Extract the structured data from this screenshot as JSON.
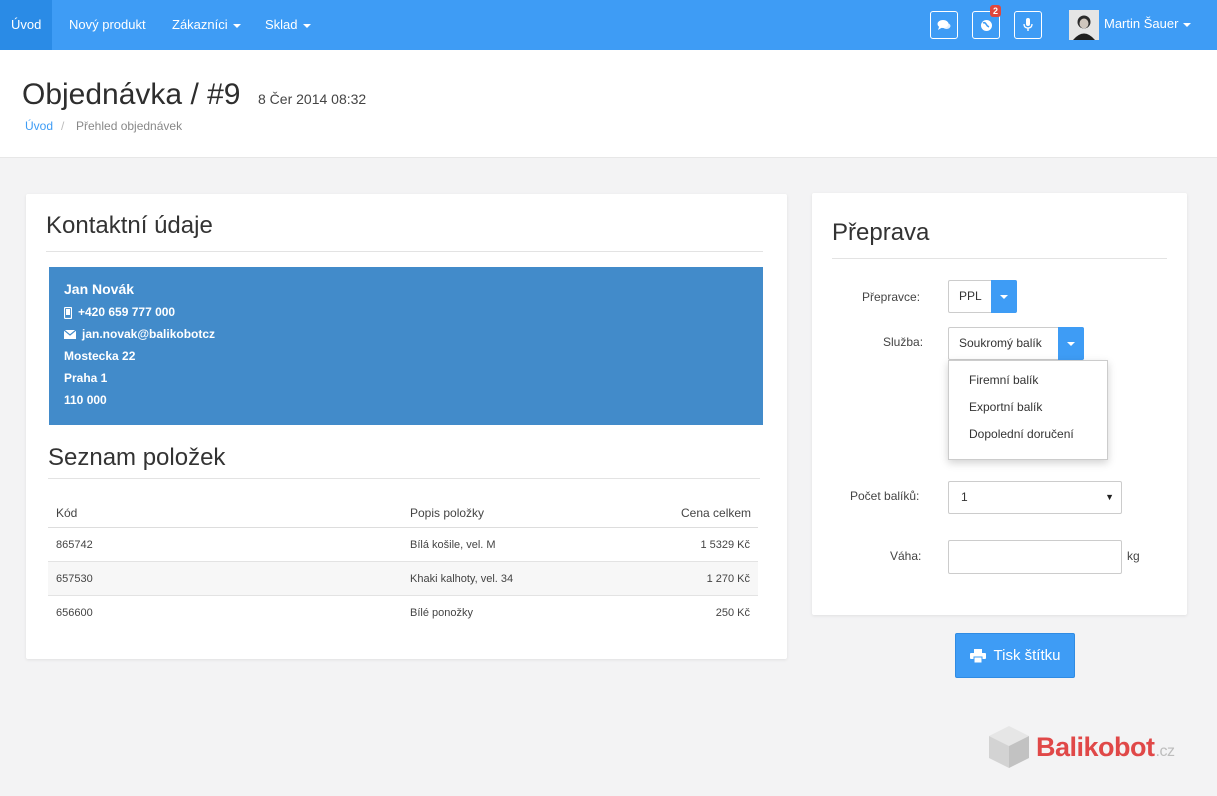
{
  "nav": {
    "items": [
      {
        "label": "Úvod",
        "active": true
      },
      {
        "label": "Nový produkt"
      },
      {
        "label": "Zákazníci"
      },
      {
        "label": "Sklad"
      }
    ],
    "notifications_badge": "2",
    "user_name": "Martin Šauer",
    "icons": [
      "comments-icon",
      "globe-icon",
      "microphone-icon"
    ]
  },
  "header": {
    "title": "Objednávka / #9",
    "date": "8 Čer 2014 08:32",
    "breadcrumb_home": "Úvod",
    "breadcrumb_separator": "/",
    "breadcrumb_current": "Přehled objednávek"
  },
  "contact": {
    "section_title": "Kontaktní údaje",
    "name": "Jan Novák",
    "phone": "+420 659 777 000",
    "email": "jan.novak@balikobotcz",
    "street": "Mostecka 22",
    "city": "Praha 1",
    "zip": "110 000"
  },
  "items": {
    "section_title": "Seznam položek",
    "headers": [
      "Kód",
      "Popis položky",
      "Cena celkem"
    ],
    "rows": [
      [
        "865742",
        "Bílá košile, vel. M",
        "1 5329 Kč"
      ],
      [
        "657530",
        "Khaki kalhoty, vel. 34",
        "1 270 Kč"
      ],
      [
        "656600",
        "Bílé ponožky",
        "250 Kč"
      ]
    ]
  },
  "shipping": {
    "section_title": "Přeprava",
    "carrier_label": "Přepravce:",
    "carrier_value": "PPL",
    "service_label": "Služba:",
    "service_value": "Soukromý balík",
    "service_options": [
      "Firemní balík",
      "Exportní balík",
      "Dopolední doručení"
    ],
    "packages_label": "Počet balíků:",
    "packages_value": "1",
    "weight_label": "Váha:",
    "weight_value": "",
    "weight_unit": "kg",
    "print_button": "Tisk štítku"
  },
  "logo": {
    "name": "Balikobot",
    "tld": ".cz"
  },
  "colors": {
    "accent": "#3e9cf5",
    "contact_bg": "#428bca",
    "logo_red": "#e04848",
    "badge": "#e0463c"
  }
}
